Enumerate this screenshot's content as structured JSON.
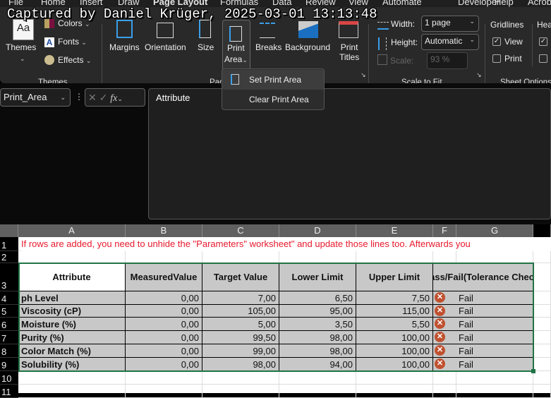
{
  "watermark": "Captured by Daniel Krüger, 2025-03-01 13:13:48",
  "menu": [
    "File",
    "Home",
    "Insert",
    "Draw",
    "Page Layout",
    "Formulas",
    "Data",
    "Review",
    "View",
    "Automate",
    "Developer",
    "Help",
    "Acrobat"
  ],
  "ribbon": {
    "themes": {
      "themes": "Themes",
      "colors": "Colors",
      "fonts": "Fonts",
      "effects": "Effects",
      "group": "Themes"
    },
    "page_setup": {
      "margins": "Margins",
      "orientation": "Orientation",
      "size": "Size",
      "print_area_1": "Print",
      "print_area_2": "Area",
      "breaks": "Breaks",
      "background": "Background",
      "print_titles_1": "Print",
      "print_titles_2": "Titles",
      "group": "Page Setup"
    },
    "scale": {
      "width_label": "Width:",
      "width_value": "1 page",
      "height_label": "Height:",
      "height_value": "Automatic",
      "scale_label": "Scale:",
      "scale_value": "93 %",
      "group": "Scale to Fit"
    },
    "sheet_options": {
      "gridlines": "Gridlines",
      "headings": "Headings",
      "view": "View",
      "print": "Print",
      "group": "Sheet Options",
      "gridlines_view": true,
      "gridlines_print": false
    }
  },
  "dropdown": {
    "set": "Set Print Area",
    "clear": "Clear Print Area"
  },
  "formula_bar": {
    "name_box": "Print_Area",
    "fx": "fx",
    "content": "Attribute"
  },
  "columns": [
    "A",
    "B",
    "C",
    "D",
    "E",
    "F",
    "G"
  ],
  "rows": [
    "1",
    "2",
    "3",
    "4",
    "5",
    "6",
    "7",
    "8",
    "9",
    "10",
    "11"
  ],
  "note": "If rows are added, you need to unhide the \"Parameters\" worksheet\" and update those lines too. Afterwards you",
  "table": {
    "headers": {
      "attribute": "Attribute",
      "measured_1": "Measured",
      "measured_2": "Value",
      "target": "Target Value",
      "lower": "Lower Limit",
      "upper": "Upper Limit",
      "pf_1": "Pass/Fail",
      "pf_2": "(Tolerance Check)"
    },
    "rows": [
      {
        "attribute": "ph Level",
        "measured": "0,00",
        "target": "7,00",
        "lower": "6,50",
        "upper": "7,50",
        "result": "Fail"
      },
      {
        "attribute": "Viscosity (cP)",
        "measured": "0,00",
        "target": "105,00",
        "lower": "95,00",
        "upper": "115,00",
        "result": "Fail"
      },
      {
        "attribute": "Moisture (%)",
        "measured": "0,00",
        "target": "5,00",
        "lower": "3,50",
        "upper": "5,50",
        "result": "Fail"
      },
      {
        "attribute": "Purity (%)",
        "measured": "0,00",
        "target": "99,50",
        "lower": "98,00",
        "upper": "100,00",
        "result": "Fail"
      },
      {
        "attribute": "Color Match (%)",
        "measured": "0,00",
        "target": "99,00",
        "lower": "98,00",
        "upper": "100,00",
        "result": "Fail"
      },
      {
        "attribute": "Solubility (%)",
        "measured": "0,00",
        "target": "98,00",
        "lower": "94,00",
        "upper": "100,00",
        "result": "Fail"
      }
    ]
  },
  "colors": {
    "note": "#e8192c",
    "selection": "#217346",
    "fail_icon": "#c0502f",
    "table_fill": "#c8c8c8"
  }
}
